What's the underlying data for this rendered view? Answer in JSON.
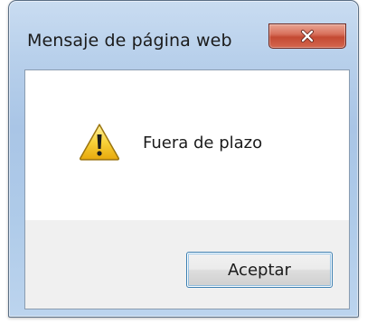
{
  "window": {
    "title": "Mensaje de página web",
    "close_icon": "close-icon"
  },
  "dialog": {
    "icon": "warning-icon",
    "message": "Fuera de plazo",
    "ok_label": "Aceptar"
  },
  "colors": {
    "frame": "#b8d0eb",
    "close_button": "#c44a33",
    "ok_button_border": "#3c7fb1",
    "warning_fill": "#f5c518"
  }
}
